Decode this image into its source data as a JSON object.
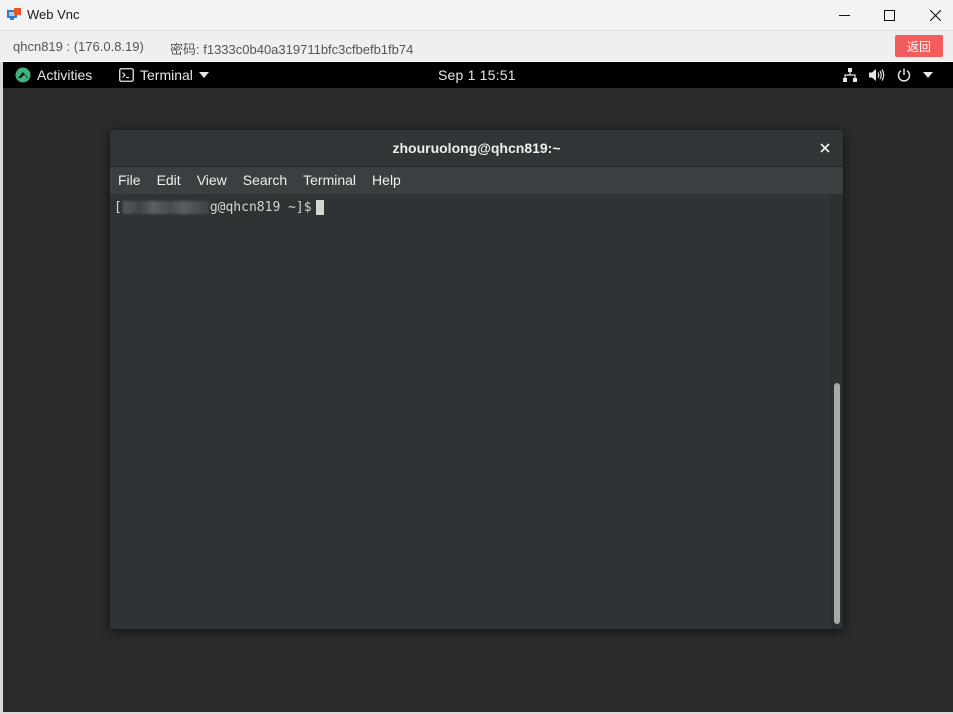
{
  "window": {
    "title": "Web Vnc",
    "icon": "web-vnc-app-icon",
    "controls": [
      "minimize-icon",
      "maximize-icon",
      "close-icon"
    ]
  },
  "infobar": {
    "host": "qhcn819 : (176.0.8.19)",
    "password": "密码: f1333c0b40a319711bfc3cfbefb1fb74",
    "back_label": "返回"
  },
  "gnome_topbar": {
    "activities_label": "Activities",
    "app_menu_label": "Terminal",
    "clock": "Sep 1  15:51",
    "status_icons": [
      "network-icon",
      "volume-icon",
      "power-icon",
      "caret-down-icon"
    ]
  },
  "terminal": {
    "title": "zhouruolong@qhcn819:~",
    "menu": [
      "File",
      "Edit",
      "View",
      "Search",
      "Terminal",
      "Help"
    ],
    "prompt_open": "[",
    "prompt_rest": "g@qhcn819 ~]$"
  },
  "colors": {
    "back_button": "#f25c5c",
    "gnome_topbar": "#000000",
    "terminal_bg": "#2e3436",
    "activities_logo": "#3fb27f"
  }
}
